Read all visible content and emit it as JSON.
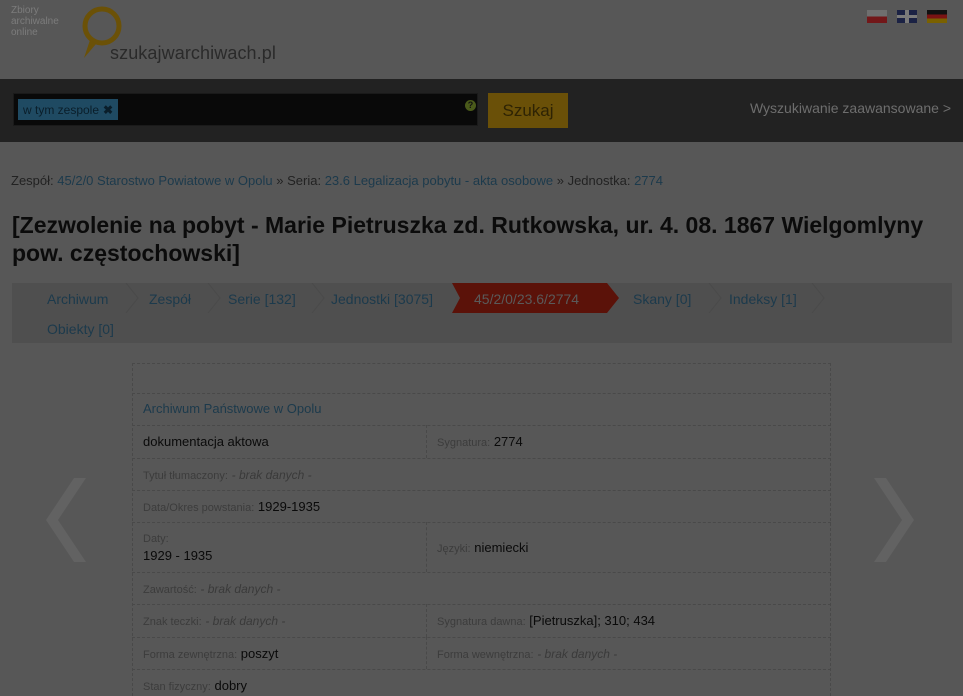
{
  "header": {
    "tagline": "Zbiory archiwalne online",
    "logo_text": "szukajwarchiwach.pl",
    "flags": [
      "pl-flag",
      "gb-flag",
      "de-flag"
    ]
  },
  "search": {
    "scope_tag": "w tym zespole",
    "scope_remove": "✖",
    "help": "?",
    "button": "Szukaj",
    "advanced": "Wyszukiwanie zaawansowane >"
  },
  "breadcrumb": {
    "zespol_label": "Zespół:",
    "zespol_value": "45/2/0 Starostwo Powiatowe w Opolu",
    "sep": "»",
    "seria_label": "Seria:",
    "seria_value": "23.6 Legalizacja pobytu - akta osobowe",
    "jednostka_label": "Jednostka:",
    "jednostka_value": "2774"
  },
  "title": "[Zezwolenie na pobyt - Marie Pietruszka zd. Rutkowska, ur. 4. 08. 1867 Wielgomlyny pow. częstochowski]",
  "tabs": {
    "archiwum": "Archiwum",
    "zespol": "Zespół",
    "serie": "Serie [132]",
    "jednostki": "Jednostki [3075]",
    "active": "45/2/0/23.6/2774",
    "skany": "Skany [0]",
    "indeksy": "Indeksy [1]",
    "obiekty": "Obiekty [0]"
  },
  "details": {
    "archive": "Archiwum Państwowe w Opolu",
    "type": "dokumentacja aktowa",
    "sygnatura_label": "Sygnatura:",
    "sygnatura": "2774",
    "tytul_label": "Tytuł tłumaczony:",
    "no_data": "- brak danych -",
    "okres_label": "Data/Okres powstania:",
    "okres": "1929-1935",
    "daty_label": "Daty:",
    "daty": "1929 - 1935",
    "jezyki_label": "Języki:",
    "jezyki": "niemiecki",
    "zawartosc_label": "Zawartość:",
    "znak_label": "Znak teczki:",
    "sygn_dawna_label": "Sygnatura dawna:",
    "sygn_dawna": "[Pietruszka]; 310; 434",
    "forma_zew_label": "Forma zewnętrzna:",
    "forma_zew": "poszyt",
    "forma_wew_label": "Forma wewnętrzna:",
    "stan_label": "Stan fizyczny:",
    "stan": "dobry"
  },
  "colors": {
    "overlay_bg": "#575757",
    "link": "#1c3a4c",
    "active_tab": "#5b1209",
    "search_button": "#6a5008"
  }
}
